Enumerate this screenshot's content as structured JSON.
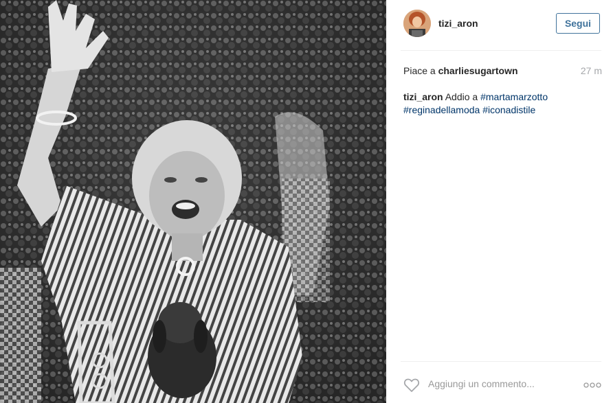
{
  "post": {
    "username": "tizi_aron",
    "follow_label": "Segui",
    "likes_prefix": "Piace a",
    "likes_user": "charliesugartown",
    "time_ago": "27 m",
    "caption_user": "tizi_aron",
    "caption_text": "Addio a",
    "hashtags": [
      "#martamarzotto",
      "#reginadellamoda",
      "#iconadistile"
    ],
    "comment_placeholder": "Aggiungi un commento...",
    "icons": {
      "like": "heart-icon",
      "more": "more-options-icon"
    }
  },
  "colors": {
    "accent": "#3f729b",
    "hashtag": "#003569",
    "muted": "#a5a7aa"
  }
}
